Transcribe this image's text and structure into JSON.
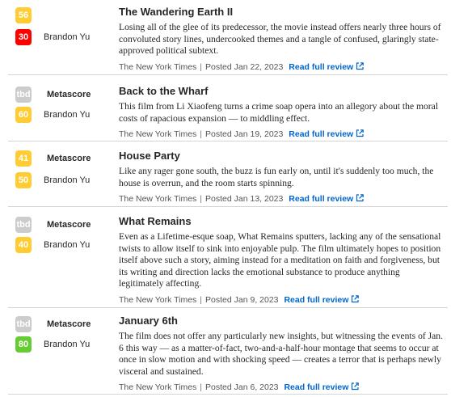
{
  "reviews": [
    {
      "metascore": "56",
      "metascore_color": "yellow",
      "metascore_label": "",
      "critic_score": "30",
      "critic_score_color": "red",
      "critic": "Brandon Yu",
      "title": "The Wandering Earth II",
      "summary": "Losing all of the glee of its predecessor, the movie instead offers nearly three hours of convoluted story lines, undercooked themes and a tangle of confused, glaringly state-approved political subtext.",
      "publication": "The New York Times",
      "posted": "Posted Jan 22, 2023",
      "link": "Read full review"
    },
    {
      "metascore": "tbd",
      "metascore_color": "tbd",
      "metascore_label": "Metascore",
      "critic_score": "60",
      "critic_score_color": "yellow",
      "critic": "Brandon Yu",
      "title": "Back to the Wharf",
      "summary": "This film from Li Xiaofeng turns a crime soap opera into an allegory about the moral costs of rapacious expansion — to middling effect.",
      "publication": "The New York Times",
      "posted": "Posted Jan 19, 2023",
      "link": "Read full review"
    },
    {
      "metascore": "41",
      "metascore_color": "yellow",
      "metascore_label": "Metascore",
      "critic_score": "50",
      "critic_score_color": "yellow",
      "critic": "Brandon Yu",
      "title": "House Party",
      "summary": "Like any rager gone south, the buzz is fun early on, until it's suddenly too much, the house is overrun, and the room starts spinning.",
      "publication": "The New York Times",
      "posted": "Posted Jan 13, 2023",
      "link": "Read full review"
    },
    {
      "metascore": "tbd",
      "metascore_color": "tbd",
      "metascore_label": "Metascore",
      "critic_score": "40",
      "critic_score_color": "yellow",
      "critic": "Brandon Yu",
      "title": "What Remains",
      "summary": "Even as a Lifetime-esque soap, What Remains sputters, lacking any of the sensational twists to allow itself to sink into enjoyable pulp. The film ultimately hopes to position itself above such a story, aiming instead for a meditation on faith and forgiveness, but its writing and direction lacks the emotional substance to produce anything legitimately affecting.",
      "publication": "The New York Times",
      "posted": "Posted Jan 9, 2023",
      "link": "Read full review"
    },
    {
      "metascore": "tbd",
      "metascore_color": "tbd",
      "metascore_label": "Metascore",
      "critic_score": "80",
      "critic_score_color": "green",
      "critic": "Brandon Yu",
      "title": "January 6th",
      "summary": "The film does not offer any particularly new insights, but witnessing the events of Jan. 6 this way — as a matter-of-fact, two-and-a-half-hour montage that seems to occur at once in slow motion and with shocking speed — creates a terror that is perhaps newly visceral and sustained.",
      "publication": "The New York Times",
      "posted": "Posted Jan 6, 2023",
      "link": "Read full review"
    }
  ],
  "icons": {
    "external_link": "external-link-icon"
  },
  "colors": {
    "yellow": "#ffcc33",
    "red": "#ff0000",
    "green": "#66cc33",
    "tbd": "#cccccc",
    "link": "#0066cc"
  }
}
